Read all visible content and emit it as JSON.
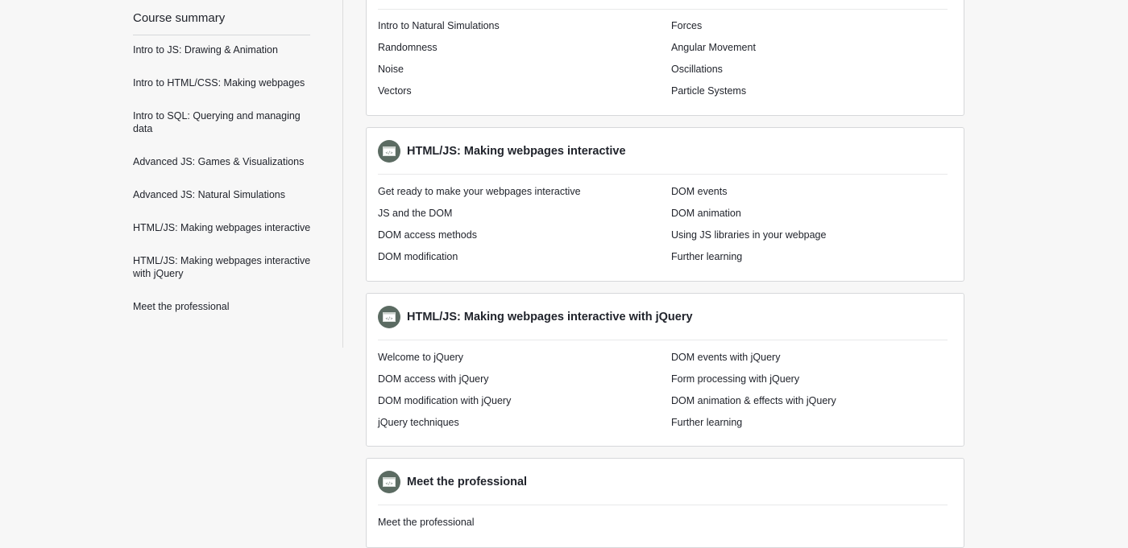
{
  "sidebar": {
    "title": "Course summary",
    "items": [
      "Intro to JS: Drawing & Animation",
      "Intro to HTML/CSS: Making webpages",
      "Intro to SQL: Querying and managing data",
      "Advanced JS: Games & Visualizations",
      "Advanced JS: Natural Simulations",
      "HTML/JS: Making webpages interactive",
      "HTML/JS: Making webpages interactive with jQuery",
      "Meet the professional"
    ]
  },
  "units": [
    {
      "title": "",
      "icon": "code-window-icon",
      "left_lessons": [
        "Intro to Natural Simulations",
        "Randomness",
        "Noise",
        "Vectors"
      ],
      "right_lessons": [
        "Forces",
        "Angular Movement",
        "Oscillations",
        "Particle Systems"
      ]
    },
    {
      "title": "HTML/JS: Making webpages interactive",
      "icon": "code-window-icon",
      "left_lessons": [
        "Get ready to make your webpages interactive",
        "JS and the DOM",
        "DOM access methods",
        "DOM modification"
      ],
      "right_lessons": [
        "DOM events",
        "DOM animation",
        "Using JS libraries in your webpage",
        "Further learning"
      ]
    },
    {
      "title": "HTML/JS: Making webpages interactive with jQuery",
      "icon": "code-window-icon",
      "left_lessons": [
        "Welcome to jQuery",
        "DOM access with jQuery",
        "DOM modification with jQuery",
        "jQuery techniques"
      ],
      "right_lessons": [
        "DOM events with jQuery",
        "Form processing with jQuery",
        "DOM animation & effects with jQuery",
        "Further learning"
      ]
    },
    {
      "title": "Meet the professional",
      "icon": "code-window-icon",
      "left_lessons": [
        "Meet the professional"
      ],
      "right_lessons": []
    }
  ]
}
